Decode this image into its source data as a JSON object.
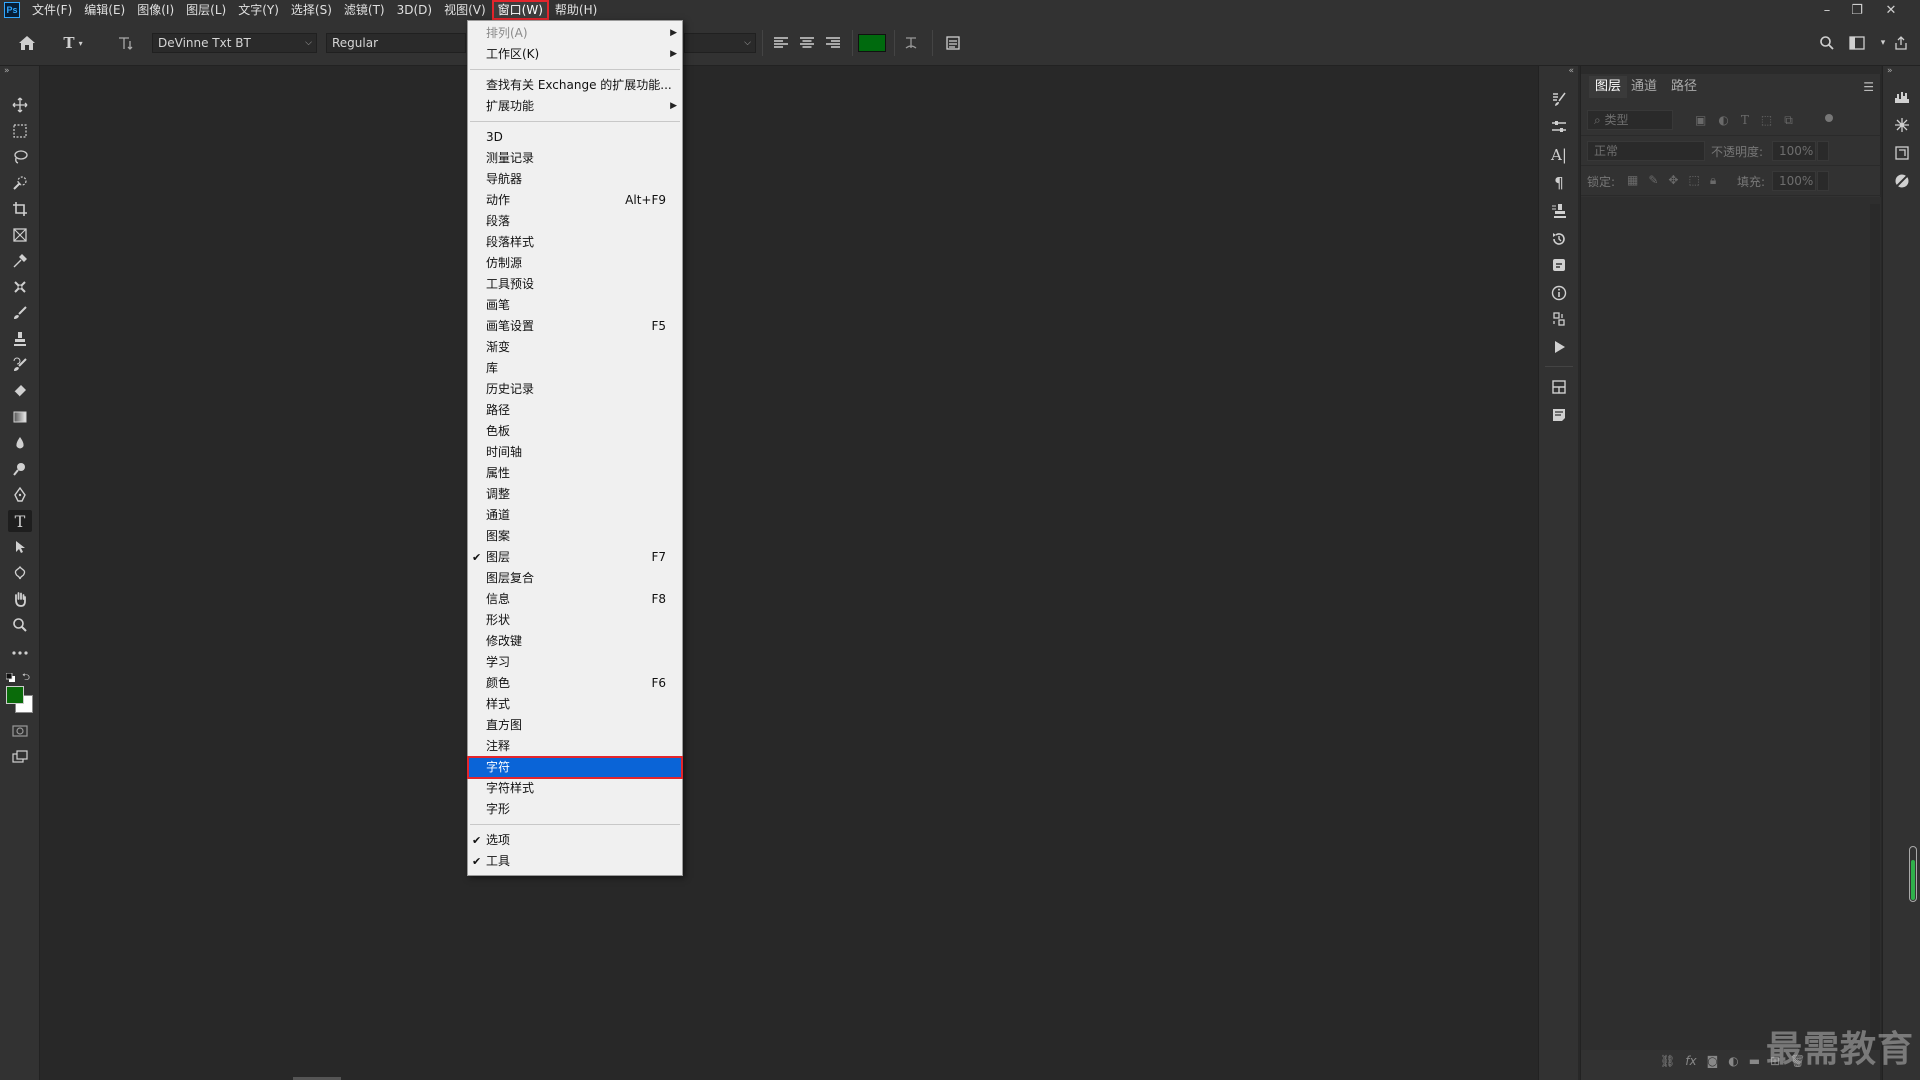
{
  "app": {
    "logo_text": "Ps"
  },
  "menubar": {
    "items": [
      "文件(F)",
      "编辑(E)",
      "图像(I)",
      "图层(L)",
      "文字(Y)",
      "选择(S)",
      "滤镜(T)",
      "3D(D)",
      "视图(V)",
      "窗口(W)",
      "帮助(H)"
    ],
    "active_index": 9
  },
  "window_controls": {
    "minimize": "–",
    "restore": "❐",
    "close": "✕"
  },
  "options_bar": {
    "font_family": "DeVinne Txt BT",
    "font_style": "Regular",
    "text_color": "#006a0e"
  },
  "colors": {
    "foreground": "#0a6b0a",
    "background": "#ffffff",
    "menu_highlight": "#0a64d7",
    "callout": "#e3252c"
  },
  "window_menu": [
    {
      "label": "排列(A)",
      "submenu": true,
      "disabled": true
    },
    {
      "label": "工作区(K)",
      "submenu": true
    },
    {
      "separator": true
    },
    {
      "label": "查找有关 Exchange 的扩展功能..."
    },
    {
      "label": "扩展功能",
      "submenu": true
    },
    {
      "separator": true
    },
    {
      "label": "3D"
    },
    {
      "label": "测量记录"
    },
    {
      "label": "导航器"
    },
    {
      "label": "动作",
      "shortcut": "Alt+F9"
    },
    {
      "label": "段落"
    },
    {
      "label": "段落样式"
    },
    {
      "label": "仿制源"
    },
    {
      "label": "工具预设"
    },
    {
      "label": "画笔"
    },
    {
      "label": "画笔设置",
      "shortcut": "F5"
    },
    {
      "label": "渐变"
    },
    {
      "label": "库"
    },
    {
      "label": "历史记录"
    },
    {
      "label": "路径"
    },
    {
      "label": "色板"
    },
    {
      "label": "时间轴"
    },
    {
      "label": "属性"
    },
    {
      "label": "调整"
    },
    {
      "label": "通道"
    },
    {
      "label": "图案"
    },
    {
      "label": "图层",
      "shortcut": "F7",
      "checked": true
    },
    {
      "label": "图层复合"
    },
    {
      "label": "信息",
      "shortcut": "F8"
    },
    {
      "label": "形状"
    },
    {
      "label": "修改键"
    },
    {
      "label": "学习"
    },
    {
      "label": "颜色",
      "shortcut": "F6"
    },
    {
      "label": "样式"
    },
    {
      "label": "直方图"
    },
    {
      "label": "注释"
    },
    {
      "label": "字符",
      "highlighted": true
    },
    {
      "label": "字符样式"
    },
    {
      "label": "字形"
    },
    {
      "separator": true
    },
    {
      "label": "选项",
      "checked": true
    },
    {
      "label": "工具",
      "checked": true
    }
  ],
  "layers_panel": {
    "tabs": [
      "图层",
      "通道",
      "路径"
    ],
    "active_tab": 0,
    "filter_label": "类型",
    "blend_mode": "正常",
    "opacity_label": "不透明度:",
    "opacity_value": "100%",
    "lock_label": "锁定:",
    "fill_label": "填充:",
    "fill_value": "100%"
  },
  "watermark": "最需教育"
}
